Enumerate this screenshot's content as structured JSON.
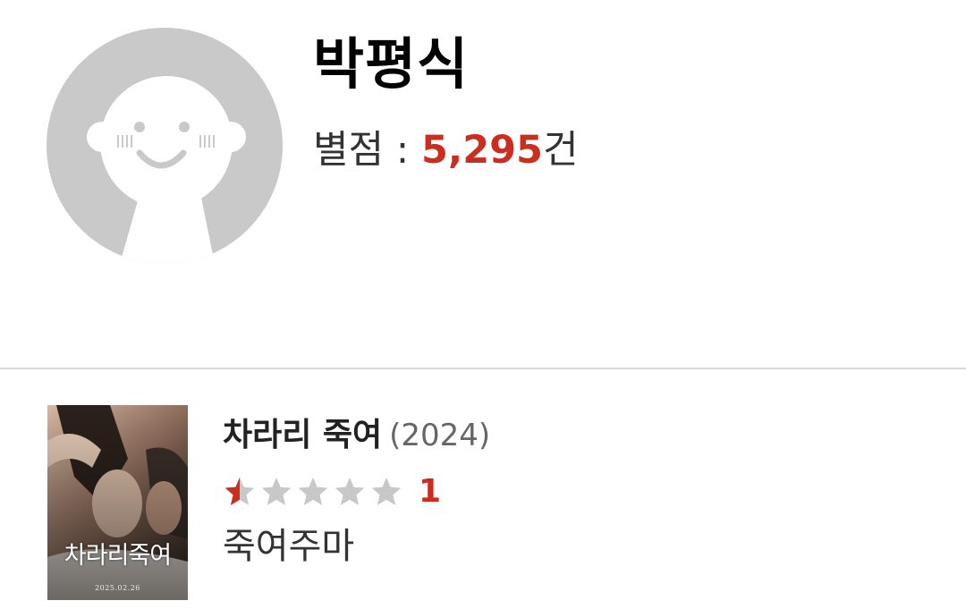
{
  "profile": {
    "name": "박평식",
    "rating_label": "별점 : ",
    "rating_count": "5,295",
    "rating_unit": "건",
    "avatar_icon": "default-avatar-icon"
  },
  "ratings": [
    {
      "title": "차라리 죽여",
      "year": "(2024)",
      "stars_out_of": 5,
      "stars_value": 0.5,
      "score": "1",
      "comment": "죽여주마",
      "poster": {
        "title_text": "차라리죽여",
        "date_text": "2025.02.26"
      }
    }
  ],
  "colors": {
    "accent_red": "#cc2d1f",
    "star_empty": "#c8c8c8",
    "avatar_gray": "#c9c9c9",
    "divider": "#d9d9d9"
  }
}
